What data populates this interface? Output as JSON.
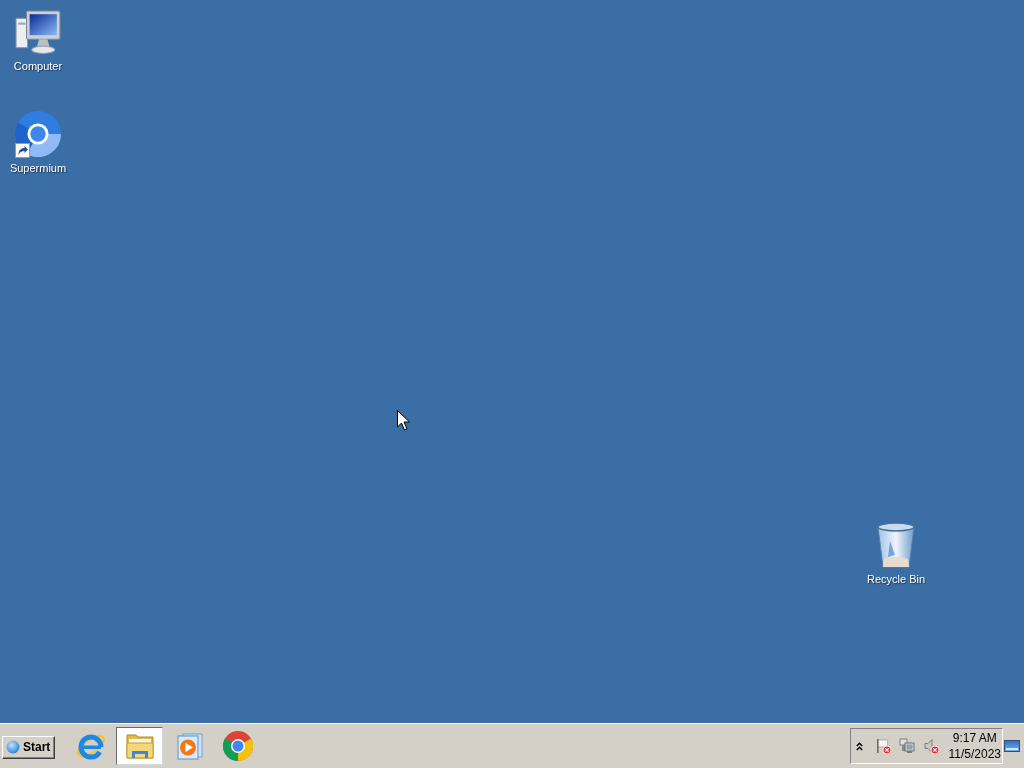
{
  "desktop_icons": [
    {
      "kind": "computer",
      "label": "Computer",
      "shortcut": false
    },
    {
      "kind": "round_browser",
      "label": "Supermium",
      "shortcut": true
    },
    {
      "kind": "recycle_bin",
      "label": "Recycle Bin",
      "shortcut": false
    }
  ],
  "taskbar": {
    "start_button": {
      "label": "Start"
    },
    "pinned": [
      {
        "kind": "e_browser",
        "selected": false
      },
      {
        "kind": "folder",
        "selected": true
      },
      {
        "kind": "media_player",
        "selected": false
      },
      {
        "kind": "tricolor_browser",
        "selected": false
      }
    ],
    "tray": {
      "icons": [
        {
          "kind": "flag",
          "alert": true
        },
        {
          "kind": "network",
          "alert": false
        },
        {
          "kind": "speaker",
          "alert": true
        }
      ],
      "time": "9:17 AM",
      "date": "11/5/2023"
    }
  }
}
